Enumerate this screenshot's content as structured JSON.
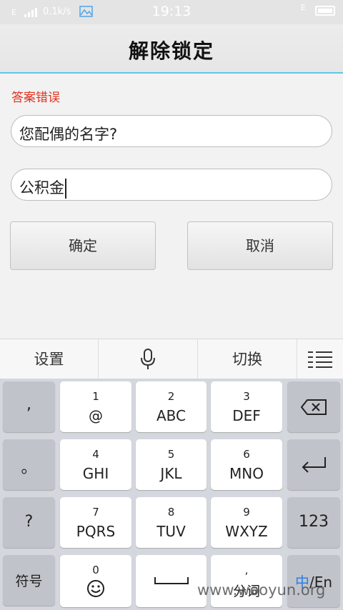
{
  "status_bar": {
    "carrier_left": "E",
    "speed": "0.1k/s",
    "time": "19:13",
    "carrier_right": "E"
  },
  "title": "解除锁定",
  "error_message": "答案错误",
  "question_field": {
    "value": "您配偶的名字?"
  },
  "answer_field": {
    "value": "公积金"
  },
  "buttons": {
    "confirm": "确定",
    "cancel": "取消"
  },
  "ime_toolbar": {
    "settings": "设置",
    "voice_icon": "microphone-icon",
    "switch": "切换",
    "menu_icon": "menu-icon"
  },
  "keyboard": {
    "left_column": [
      ",",
      "。",
      "?",
      "符号"
    ],
    "keys": [
      {
        "num": "1",
        "letters": "@"
      },
      {
        "num": "2",
        "letters": "ABC"
      },
      {
        "num": "3",
        "letters": "DEF"
      },
      {
        "num": "4",
        "letters": "GHI"
      },
      {
        "num": "5",
        "letters": "JKL"
      },
      {
        "num": "6",
        "letters": "MNO"
      },
      {
        "num": "7",
        "letters": "PQRS"
      },
      {
        "num": "8",
        "letters": "TUV"
      },
      {
        "num": "9",
        "letters": "WXYZ"
      }
    ],
    "bottom": {
      "zero_num": "0",
      "emoji_icon": "smiley-icon",
      "space_icon": "space-icon",
      "comma": ",",
      "segment": "分词",
      "lang_cn": "中",
      "lang_sep": "/En"
    },
    "right_column": {
      "backspace_icon": "backspace-icon",
      "enter_icon": "enter-icon",
      "numbers": "123"
    }
  },
  "watermark": "www.wooyun.org"
}
